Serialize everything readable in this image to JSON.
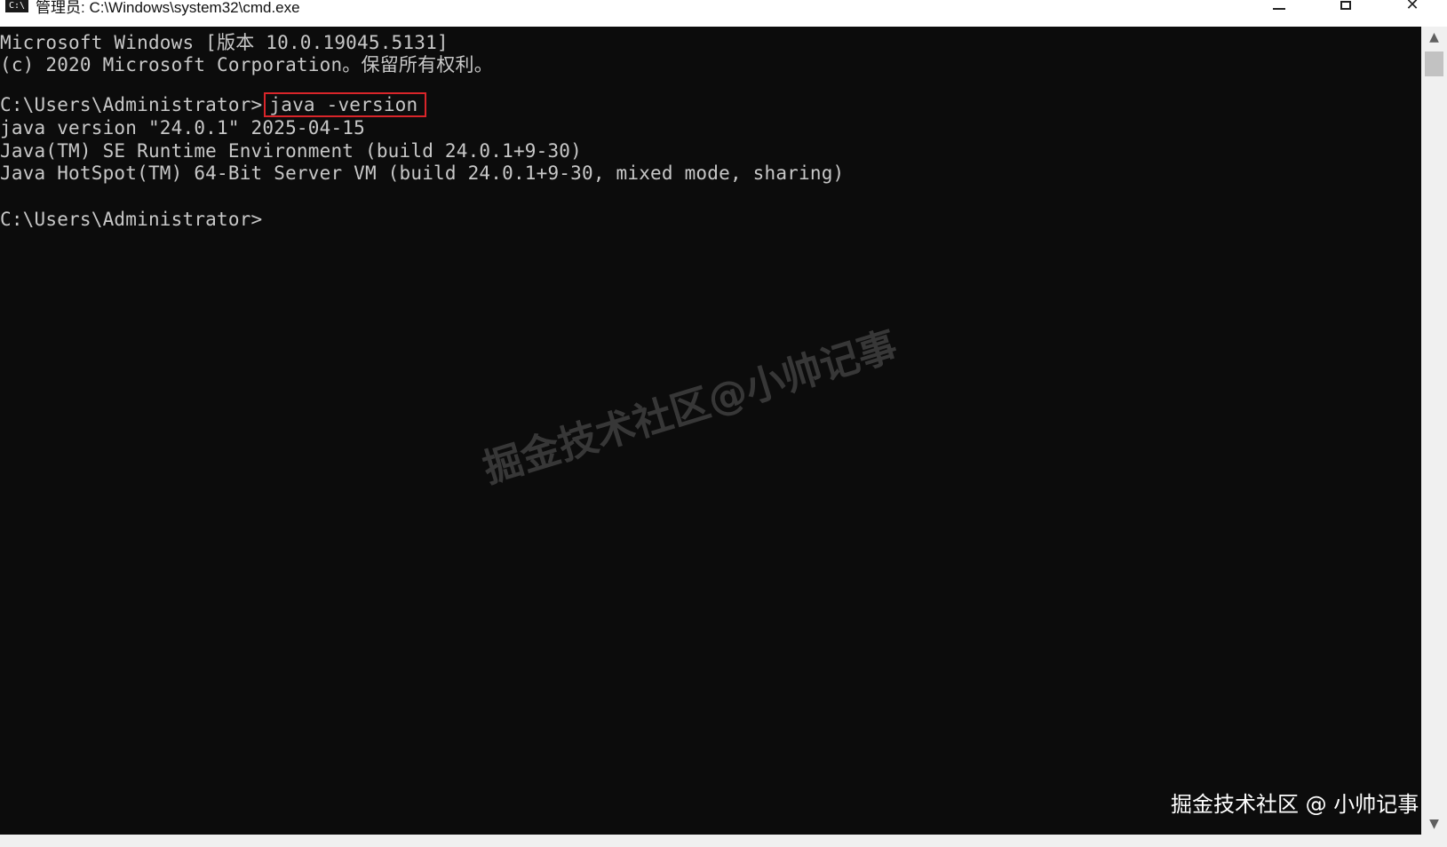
{
  "window": {
    "title": "管理员: C:\\Windows\\system32\\cmd.exe",
    "icon_label": "C:\\",
    "controls": {
      "minimize": "minimize-icon",
      "maximize": "maximize-icon",
      "close": "close-icon"
    }
  },
  "console": {
    "lines": [
      "Microsoft Windows [版本 10.0.19045.5131]",
      "(c) 2020 Microsoft Corporation。保留所有权利。",
      "",
      "C:\\Users\\Administrator>",
      "java version \"24.0.1\" 2025-04-15",
      "Java(TM) SE Runtime Environment (build 24.0.1+9-30)",
      "Java HotSpot(TM) 64-Bit Server VM (build 24.0.1+9-30, mixed mode, sharing)",
      "",
      "C:\\Users\\Administrator>"
    ],
    "highlighted_command": "java -version"
  },
  "watermark": {
    "center_text": "掘金技术社区@小帅记事",
    "corner_text": "掘金技术社区 @ 小帅记事"
  },
  "colors": {
    "console_bg": "#0c0c0c",
    "console_text": "#c8c8c8",
    "highlight_border": "#d9252a"
  }
}
